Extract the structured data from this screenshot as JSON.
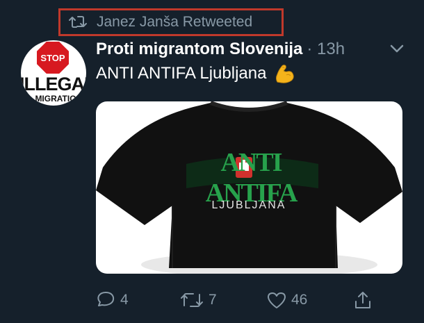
{
  "retweet": {
    "icon": "retweet-icon",
    "text": "Janez Janša Retweeted",
    "highlight_color": "#c0392b"
  },
  "author": {
    "name": "Proti migrantom Slovenija",
    "meta": "· 13h",
    "avatar": {
      "stop_text": "STOP",
      "illegal_text": "ILLEGAL",
      "immigration_text": "MIGRATIO"
    }
  },
  "tweet": {
    "text": "ANTI ANTIFA Ljubljana",
    "emoji": "flexed-biceps-icon"
  },
  "media": {
    "shirt_title": "ANTI ANTIFA",
    "shirt_subtitle": "LJUBLJANA"
  },
  "actions": {
    "reply_count": "4",
    "retweet_count": "7",
    "like_count": "46"
  },
  "colors": {
    "background": "#15202b",
    "secondary_text": "#8899a6",
    "primary_text": "#ffffff"
  }
}
